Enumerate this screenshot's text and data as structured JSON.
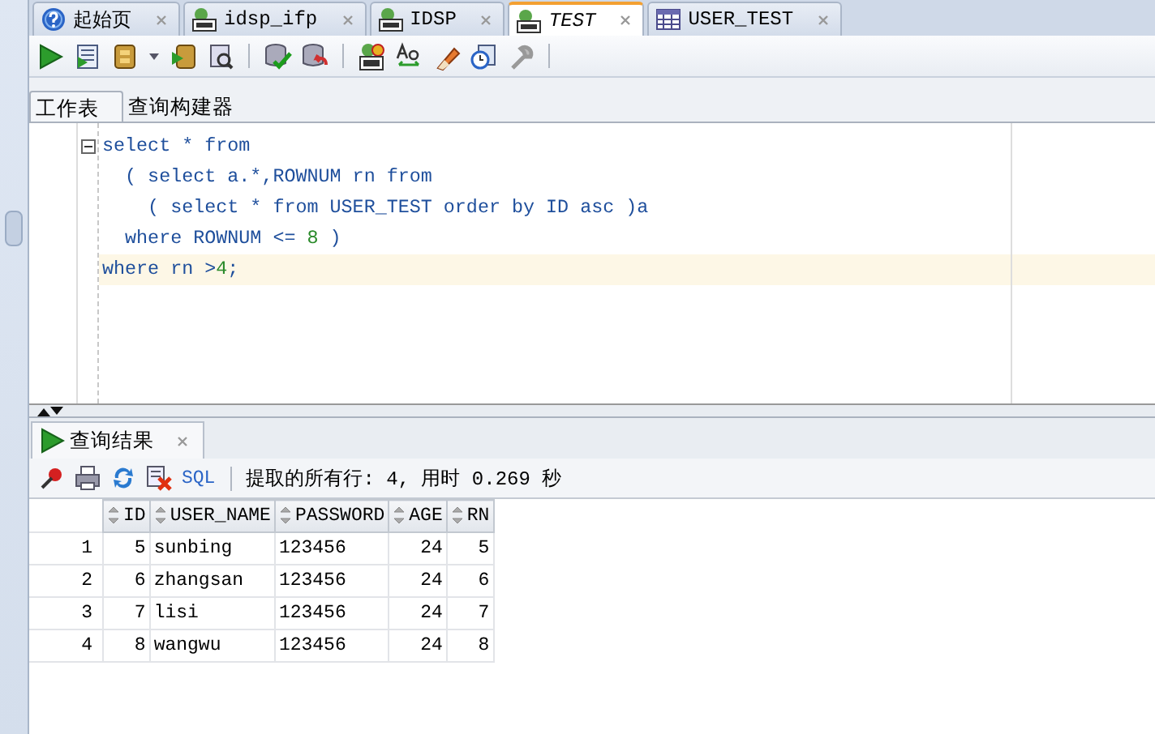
{
  "doc_tabs": [
    {
      "label": "起始页",
      "kind": "start",
      "selected": false
    },
    {
      "label": "idsp_ifp",
      "kind": "sql",
      "selected": false
    },
    {
      "label": "IDSP",
      "kind": "sql",
      "selected": false
    },
    {
      "label": "TEST",
      "kind": "sql",
      "selected": true
    },
    {
      "label": "USER_TEST",
      "kind": "table",
      "selected": false
    }
  ],
  "sub_tabs": [
    {
      "label": "工作表",
      "selected": true
    },
    {
      "label": "查询构建器",
      "selected": false
    }
  ],
  "editor": {
    "lines": [
      {
        "current": false,
        "foldable": true,
        "tokens": [
          {
            "text": "select * from",
            "kind": "keyword"
          }
        ]
      },
      {
        "current": false,
        "foldable": false,
        "tokens": [
          {
            "text": "  ( select a.*,ROWNUM rn from",
            "kind": "keyword"
          }
        ]
      },
      {
        "current": false,
        "foldable": false,
        "tokens": [
          {
            "text": "    ( select * from USER_TEST order by ID asc )a",
            "kind": "keyword"
          }
        ]
      },
      {
        "current": false,
        "foldable": false,
        "tokens": [
          {
            "text": "  where ROWNUM <= ",
            "kind": "keyword"
          },
          {
            "text": "8",
            "kind": "number"
          },
          {
            "text": " )",
            "kind": "keyword"
          }
        ]
      },
      {
        "current": true,
        "foldable": false,
        "tokens": [
          {
            "text": "where rn >",
            "kind": "keyword"
          },
          {
            "text": "4",
            "kind": "number"
          },
          {
            "text": ";",
            "kind": "keyword"
          }
        ]
      }
    ]
  },
  "results": {
    "tab": {
      "label": "查询结果",
      "selected": true
    },
    "sql_link": "SQL",
    "status": "提取的所有行: 4, 用时 0.269 秒",
    "columns": [
      {
        "label": "ID",
        "kind": "number"
      },
      {
        "label": "USER_NAME",
        "kind": "text"
      },
      {
        "label": "PASSWORD",
        "kind": "text"
      },
      {
        "label": "AGE",
        "kind": "number"
      },
      {
        "label": "RN",
        "kind": "number"
      }
    ],
    "rows": [
      {
        "number": "1",
        "cells": [
          "5",
          "sunbing",
          "123456",
          "24",
          "5"
        ]
      },
      {
        "number": "2",
        "cells": [
          "6",
          "zhangsan",
          "123456",
          "24",
          "6"
        ]
      },
      {
        "number": "3",
        "cells": [
          "7",
          "lisi",
          "123456",
          "24",
          "7"
        ]
      },
      {
        "number": "4",
        "cells": [
          "8",
          "wangwu",
          "123456",
          "24",
          "8"
        ]
      }
    ]
  }
}
